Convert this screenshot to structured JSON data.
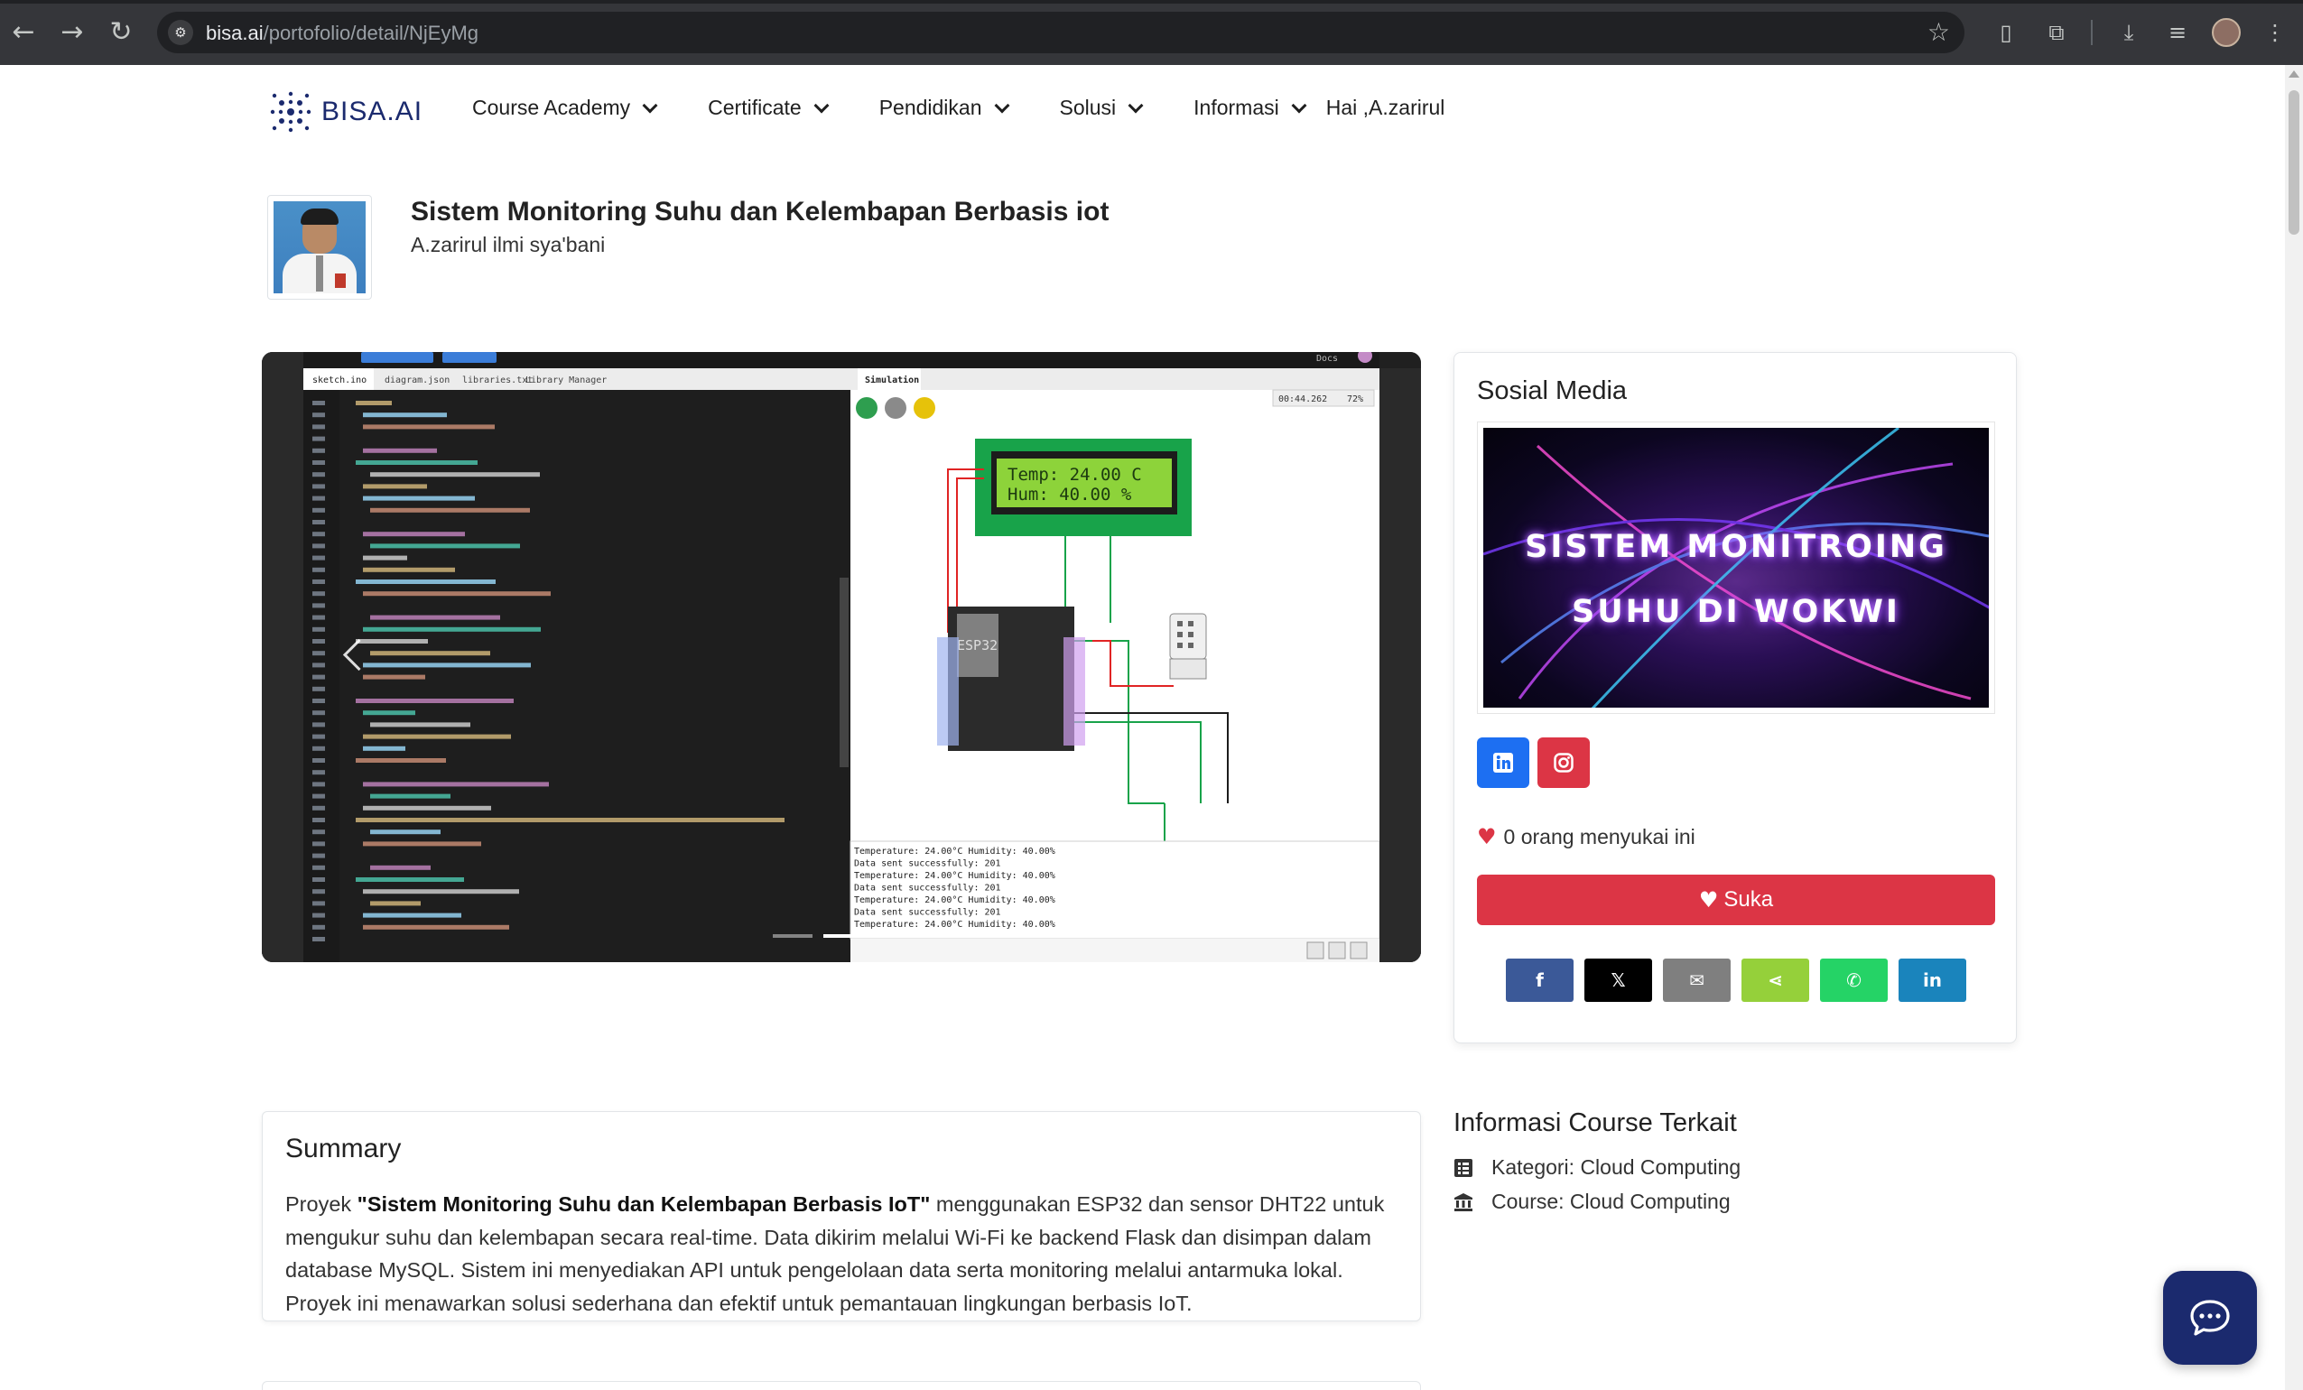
{
  "browser": {
    "url_host": "bisa.ai",
    "url_path": "/portofolio/detail/NjEyMg"
  },
  "site": {
    "logo_text": "BISA.AI",
    "menu": [
      {
        "label": "Course Academy"
      },
      {
        "label": "Certificate"
      },
      {
        "label": "Pendidikan"
      },
      {
        "label": "Solusi"
      },
      {
        "label": "Informasi"
      }
    ],
    "greeting": "Hai ,A.zarirul"
  },
  "project": {
    "title": "Sistem Monitoring Suhu dan Kelembapan Berbasis iot",
    "author": "A.zarirul ilmi sya'bani"
  },
  "carousel": {
    "screenshot": {
      "editor_tabs": [
        "sketch.ino",
        "diagram.json",
        "libraries.txt",
        "Library Manager"
      ],
      "simulation_tab": "Simulation",
      "timer": "00:44.262",
      "speed": "72%",
      "lcd_line1": "Temp: 24.00 C",
      "lcd_line2": "Hum: 40.00 %",
      "esp_label": "ESP32",
      "serial_lines": [
        "Temperature: 24.00°C  Humidity: 40.00%",
        "Data sent successfully: 201",
        "Temperature: 24.00°C  Humidity: 40.00%",
        "Data sent successfully: 201",
        "Temperature: 24.00°C  Humidity: 40.00%",
        "Data sent successfully: 201",
        "Temperature: 24.00°C  Humidity: 40.00%"
      ]
    },
    "slide_count": 2,
    "active_slide": 2
  },
  "social": {
    "title": "Sosial Media",
    "thumb_line1": "SISTEM MONITROING",
    "thumb_line2": "SUHU DI WOKWI",
    "likes_text": "0 orang menyukai ini",
    "like_button": "Suka",
    "share_buttons": [
      {
        "name": "facebook",
        "label": "f",
        "color": "#3b5998"
      },
      {
        "name": "x",
        "label": "𝕏",
        "color": "#000000"
      },
      {
        "name": "email",
        "label": "✉",
        "color": "#7f7f7f"
      },
      {
        "name": "sharethis",
        "label": "⋖",
        "color": "#95d03a"
      },
      {
        "name": "whatsapp",
        "label": "✆",
        "color": "#25d366"
      },
      {
        "name": "linkedin",
        "label": "in",
        "color": "#1a84bc"
      }
    ]
  },
  "summary": {
    "heading": "Summary",
    "intro": "Proyek ",
    "bold": "\"Sistem Monitoring Suhu dan Kelembapan Berbasis IoT\"",
    "rest": " menggunakan ESP32 dan sensor DHT22 untuk mengukur suhu dan kelembapan secara real-time. Data dikirim melalui Wi-Fi ke backend Flask dan disimpan dalam database MySQL. Sistem ini menyediakan API untuk pengelolaan data serta monitoring melalui antarmuka lokal. Proyek ini menawarkan solusi sederhana dan efektif untuk pemantauan lingkungan berbasis IoT."
  },
  "related": {
    "heading": "Informasi Course Terkait",
    "kategori": "Kategori: Cloud Computing",
    "course": "Course: Cloud Computing"
  },
  "colors": {
    "brand": "#1b2a6e",
    "danger": "#dc3545",
    "linkedin": "#1d6ff2"
  }
}
